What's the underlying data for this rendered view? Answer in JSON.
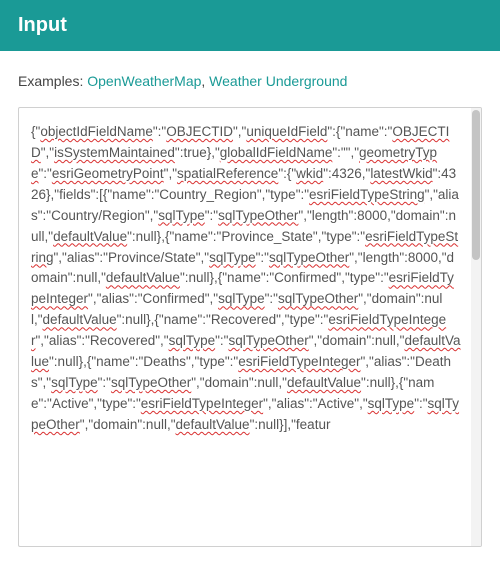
{
  "header": {
    "title": "Input"
  },
  "examples": {
    "label": "Examples:",
    "link1": "OpenWeatherMap",
    "separator": ",",
    "link2": "Weather Underground"
  },
  "input_area": {
    "segments": [
      {
        "t": "{\"",
        "err": false
      },
      {
        "t": "objectIdFieldName",
        "err": true
      },
      {
        "t": "\":\"",
        "err": false
      },
      {
        "t": "OBJECTID",
        "err": true
      },
      {
        "t": "\",\"",
        "err": false
      },
      {
        "t": "uniqueIdField",
        "err": true
      },
      {
        "t": "\":{\"name\":\"",
        "err": false
      },
      {
        "t": "OBJECTID",
        "err": true
      },
      {
        "t": "\",\"",
        "err": false
      },
      {
        "t": "isSystemMaintained",
        "err": true
      },
      {
        "t": "\":true},\"",
        "err": false
      },
      {
        "t": "globalIdFieldName",
        "err": true
      },
      {
        "t": "\":\"\",\"",
        "err": false
      },
      {
        "t": "geometryType",
        "err": true
      },
      {
        "t": "\":\"",
        "err": false
      },
      {
        "t": "esriGeometryPoint",
        "err": true
      },
      {
        "t": "\",\"",
        "err": false
      },
      {
        "t": "spatialReference",
        "err": true
      },
      {
        "t": "\":{\"",
        "err": false
      },
      {
        "t": "wkid",
        "err": true
      },
      {
        "t": "\":4326,\"",
        "err": false
      },
      {
        "t": "latestWkid",
        "err": true
      },
      {
        "t": "\":4326},\"fields\":[{\"name\":\"Country_Region\",\"type\":\"",
        "err": false
      },
      {
        "t": "esriFieldTypeString",
        "err": true
      },
      {
        "t": "\",\"alias\":\"Country/Region\",\"",
        "err": false
      },
      {
        "t": "sqlType",
        "err": true
      },
      {
        "t": "\":\"",
        "err": false
      },
      {
        "t": "sqlTypeOther",
        "err": true
      },
      {
        "t": "\",\"length\":8000,\"domain\":null,\"",
        "err": false
      },
      {
        "t": "defaultValue",
        "err": true
      },
      {
        "t": "\":null},{\"name\":\"Province_State\",\"type\":\"",
        "err": false
      },
      {
        "t": "esriFieldTypeString",
        "err": true
      },
      {
        "t": "\",\"alias\":\"Province/State\",\"",
        "err": false
      },
      {
        "t": "sqlType",
        "err": true
      },
      {
        "t": "\":\"",
        "err": false
      },
      {
        "t": "sqlTypeOther",
        "err": true
      },
      {
        "t": "\",\"length\":8000,\"domain\":null,\"",
        "err": false
      },
      {
        "t": "defaultValue",
        "err": true
      },
      {
        "t": "\":null},{\"name\":\"Confirmed\",\"type\":\"",
        "err": false
      },
      {
        "t": "esriFieldTypeInteger",
        "err": true
      },
      {
        "t": "\",\"alias\":\"Confirmed\",\"",
        "err": false
      },
      {
        "t": "sqlType",
        "err": true
      },
      {
        "t": "\":\"",
        "err": false
      },
      {
        "t": "sqlTypeOther",
        "err": true
      },
      {
        "t": "\",\"domain\":null,\"",
        "err": false
      },
      {
        "t": "defaultValue",
        "err": true
      },
      {
        "t": "\":null},{\"name\":\"Recovered\",\"type\":\"",
        "err": false
      },
      {
        "t": "esriFieldTypeInteger",
        "err": true
      },
      {
        "t": "\",\"alias\":\"Recovered\",\"",
        "err": false
      },
      {
        "t": "sqlType",
        "err": true
      },
      {
        "t": "\":\"",
        "err": false
      },
      {
        "t": "sqlTypeOther",
        "err": true
      },
      {
        "t": "\",\"domain\":null,\"",
        "err": false
      },
      {
        "t": "defaultValue",
        "err": true
      },
      {
        "t": "\":null},{\"name\":\"Deaths\",\"type\":\"",
        "err": false
      },
      {
        "t": "esriFieldTypeInteger",
        "err": true
      },
      {
        "t": "\",\"alias\":\"Deaths\",\"",
        "err": false
      },
      {
        "t": "sqlType",
        "err": true
      },
      {
        "t": "\":\"",
        "err": false
      },
      {
        "t": "sqlTypeOther",
        "err": true
      },
      {
        "t": "\",\"domain\":null,\"",
        "err": false
      },
      {
        "t": "defaultValue",
        "err": true
      },
      {
        "t": "\":null},{\"name\":\"Active\",\"type\":\"",
        "err": false
      },
      {
        "t": "esriFieldTypeInteger",
        "err": true
      },
      {
        "t": "\",\"alias\":\"Active\",\"",
        "err": false
      },
      {
        "t": "sqlType",
        "err": true
      },
      {
        "t": "\":\"",
        "err": false
      },
      {
        "t": "sqlTypeOther",
        "err": true
      },
      {
        "t": "\",\"domain\":null,\"",
        "err": false
      },
      {
        "t": "defaultValue",
        "err": true
      },
      {
        "t": "\":null}],\"featur",
        "err": false
      }
    ]
  }
}
